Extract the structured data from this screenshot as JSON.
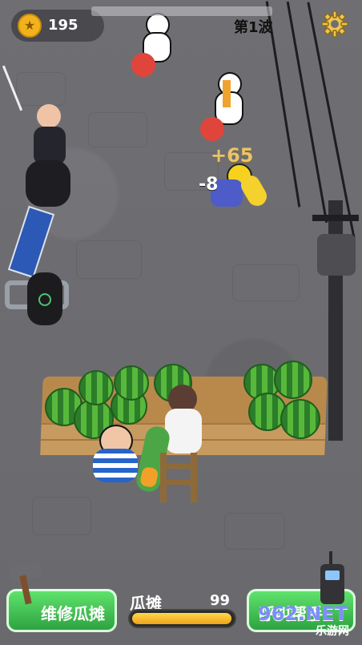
{
  "hud": {
    "coins": "195",
    "coin_symbol": "★",
    "wave_label": "第1波"
  },
  "combat": {
    "gain_text": "+65",
    "damage_text": "-8"
  },
  "stall": {
    "label": "瓜摊",
    "value": "99",
    "health_fraction": 0.99
  },
  "buttons": {
    "repair_label": "维修瓜摊",
    "call_help_label": "呼叫帮手"
  },
  "watermark": {
    "text": "962.NET",
    "sub": "乐游网"
  },
  "icons": {
    "coin": "coin-icon",
    "settings": "gear-icon",
    "hammer": "hammer-icon",
    "walkie": "walkie-talkie-icon"
  }
}
